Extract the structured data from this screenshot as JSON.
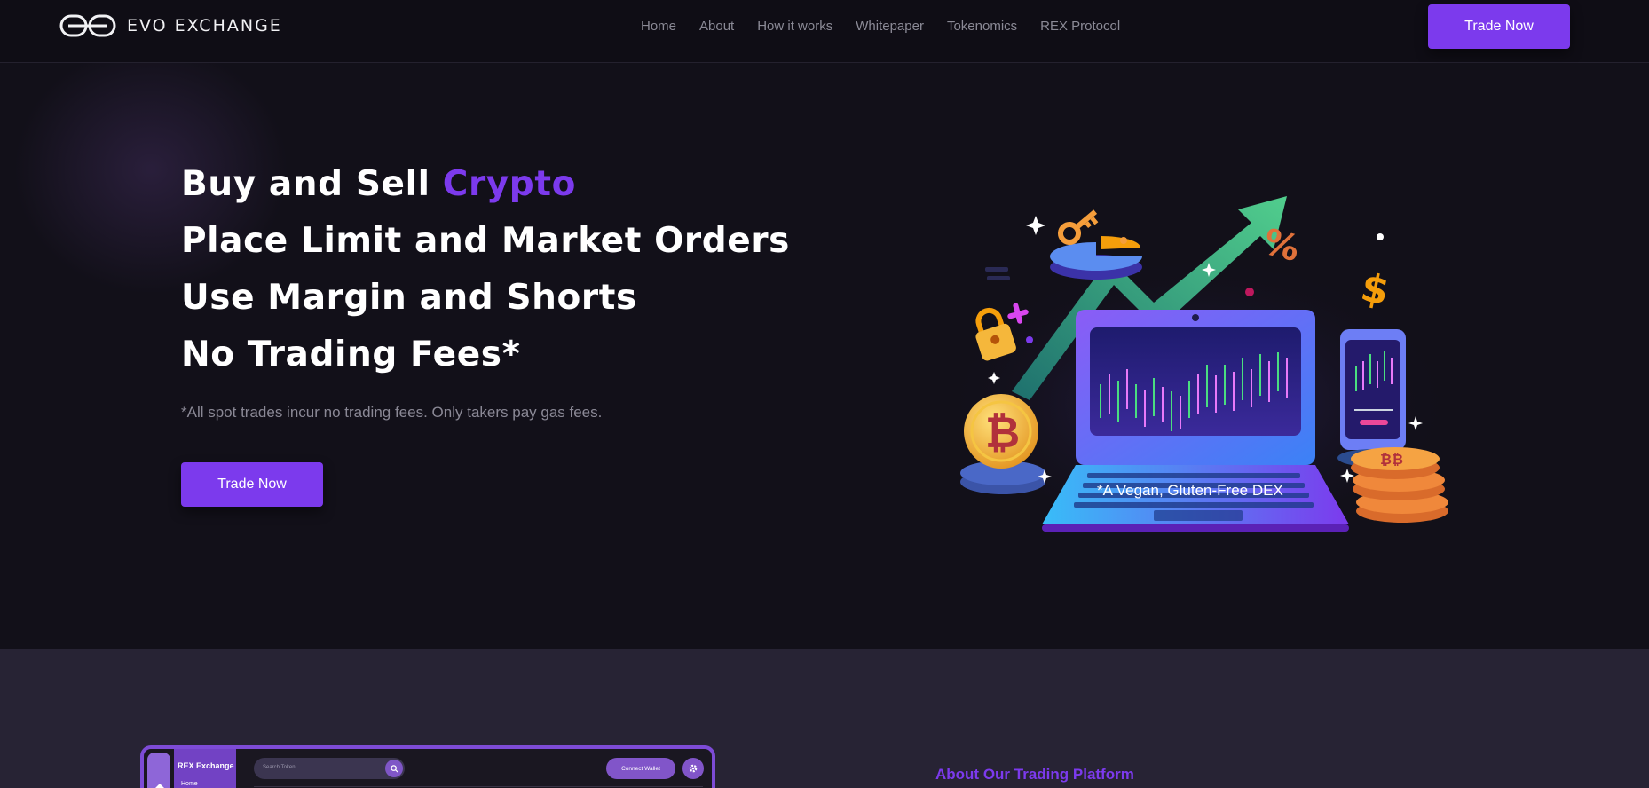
{
  "brand": {
    "name": "EVO EXCHANGE",
    "logo_icon": "evo-logo-mark"
  },
  "nav": {
    "links": [
      "Home",
      "About",
      "How it works",
      "Whitepaper",
      "Tokenomics",
      "REX Protocol"
    ],
    "cta_label": "Trade Now"
  },
  "hero": {
    "line1_prefix": "Buy and Sell ",
    "line1_accent": "Crypto",
    "line2": "Place Limit and Market Orders",
    "line3": "Use Margin and Shorts",
    "line4": "No Trading Fees*",
    "note": "*All spot trades incur no trading fees. Only takers pay gas fees.",
    "cta_label": "Trade Now",
    "illustration": "crypto-trading-laptop-illustration",
    "caption": "*A Vegan, Gluten-Free DEX"
  },
  "about": {
    "heading": "About Our Trading Platform",
    "mockup": {
      "brand": "REX Exchange",
      "home_label": "Home",
      "search_placeholder": "Search Token",
      "connect_label": "Connect Wallet",
      "search_icon": "search-icon",
      "settings_icon": "gear-icon",
      "home_icon": "home-icon"
    }
  },
  "colors": {
    "accent": "#7c3aed",
    "background": "#121019",
    "section_background": "#272334",
    "nav_text": "#8b8a96"
  }
}
